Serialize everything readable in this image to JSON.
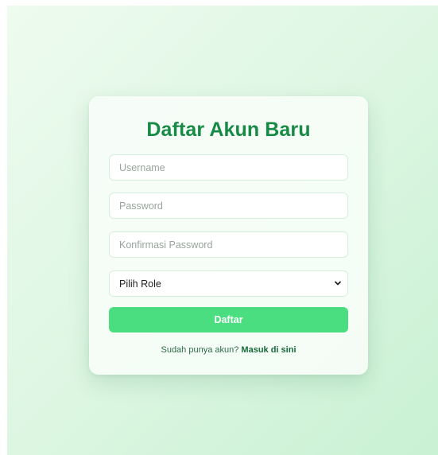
{
  "form": {
    "title": "Daftar Akun Baru",
    "username_placeholder": "Username",
    "password_placeholder": "Password",
    "confirm_placeholder": "Konfirmasi Password",
    "role_selected": "Pilih Role",
    "submit_label": "Daftar",
    "login_prompt": "Sudah punya akun?",
    "login_link": "Masuk di sini"
  },
  "colors": {
    "accent": "#4ade80",
    "title": "#178a45",
    "background": "#dff7e4"
  },
  "icons": {
    "select_arrow": "chevron-down-icon"
  }
}
